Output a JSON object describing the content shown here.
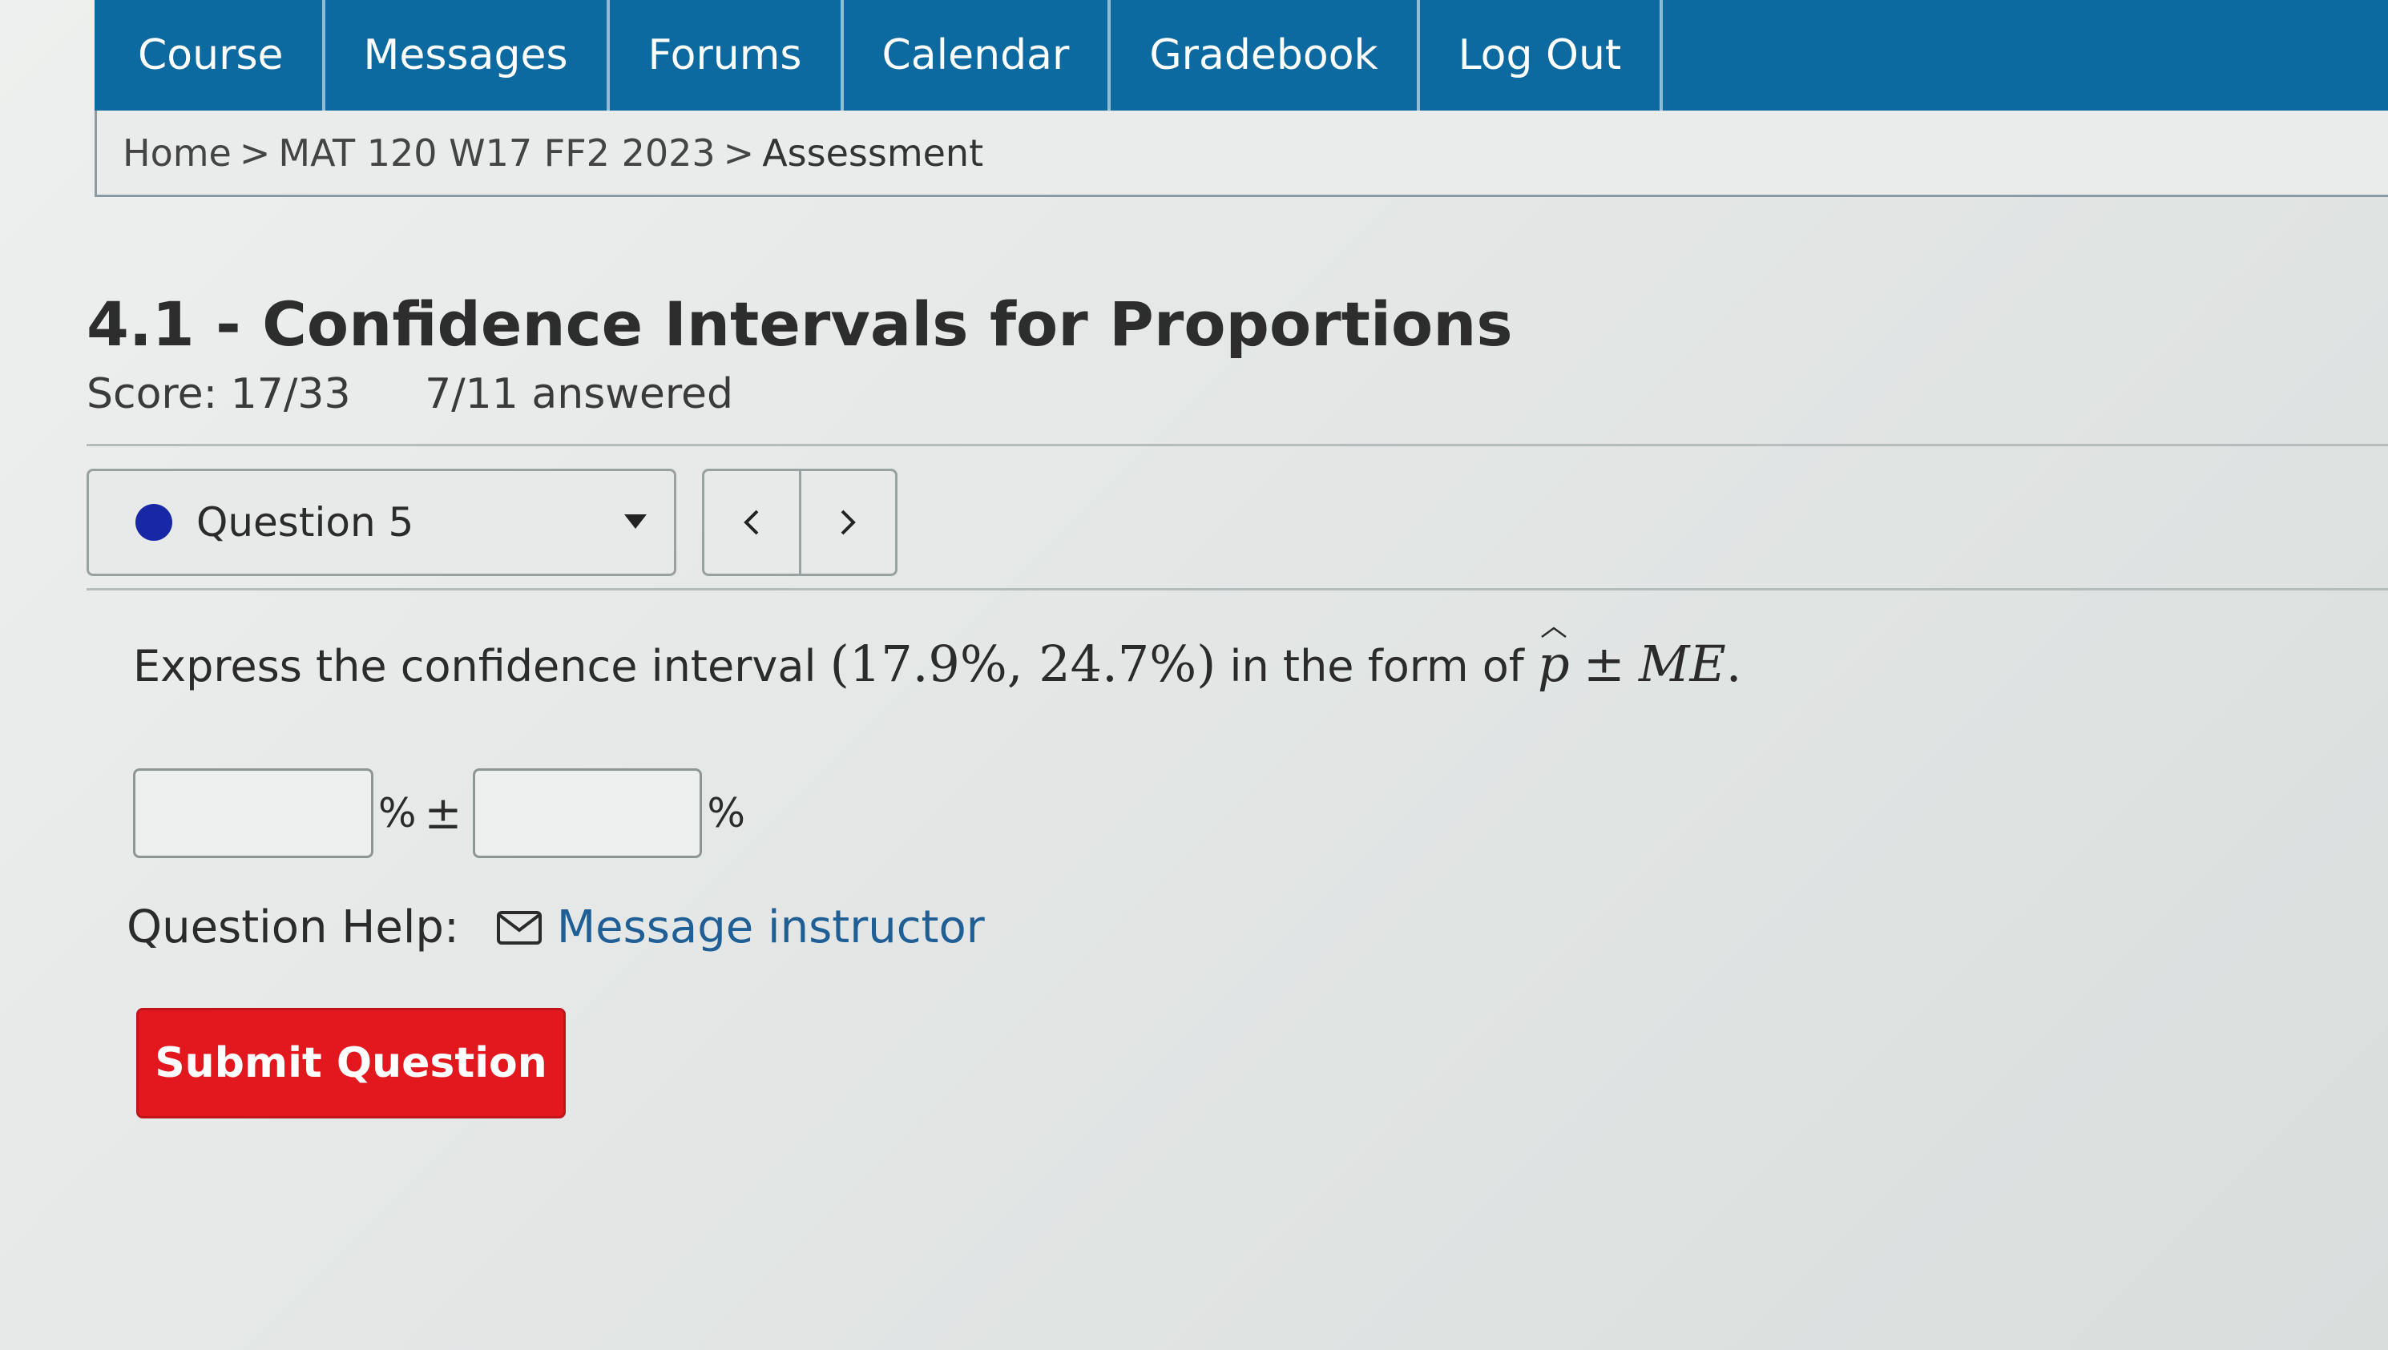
{
  "nav": {
    "tabs": [
      "Course",
      "Messages",
      "Forums",
      "Calendar",
      "Gradebook",
      "Log Out"
    ]
  },
  "breadcrumb": {
    "home": "Home",
    "course": "MAT 120 W17 FF2 2023",
    "current": "Assessment",
    "separator": ">"
  },
  "assessment": {
    "title": "4.1 - Confidence Intervals for Proportions",
    "score": "Score: 17/33",
    "answered": "7/11 answered"
  },
  "question_nav": {
    "selected": "Question 5",
    "prev_icon": "chevron-left-icon",
    "next_icon": "chevron-right-icon",
    "status_color": "#1727a6"
  },
  "question": {
    "prompt_start": "Express the confidence interval",
    "interval": "(17.9%, 24.7%)",
    "prompt_mid": "in the form of",
    "phat": "p",
    "plus_minus": "±",
    "me": "ME",
    "period": ".",
    "percent_1": "%",
    "percent_2": "%",
    "estimate_value": "",
    "margin_value": ""
  },
  "help": {
    "label": "Question Help:",
    "link": "Message instructor",
    "icon": "mail-icon"
  },
  "submit": {
    "label": "Submit Question",
    "color": "#e3171e"
  },
  "colors": {
    "nav_bg": "#0c6aa1",
    "link": "#1f5f95"
  }
}
